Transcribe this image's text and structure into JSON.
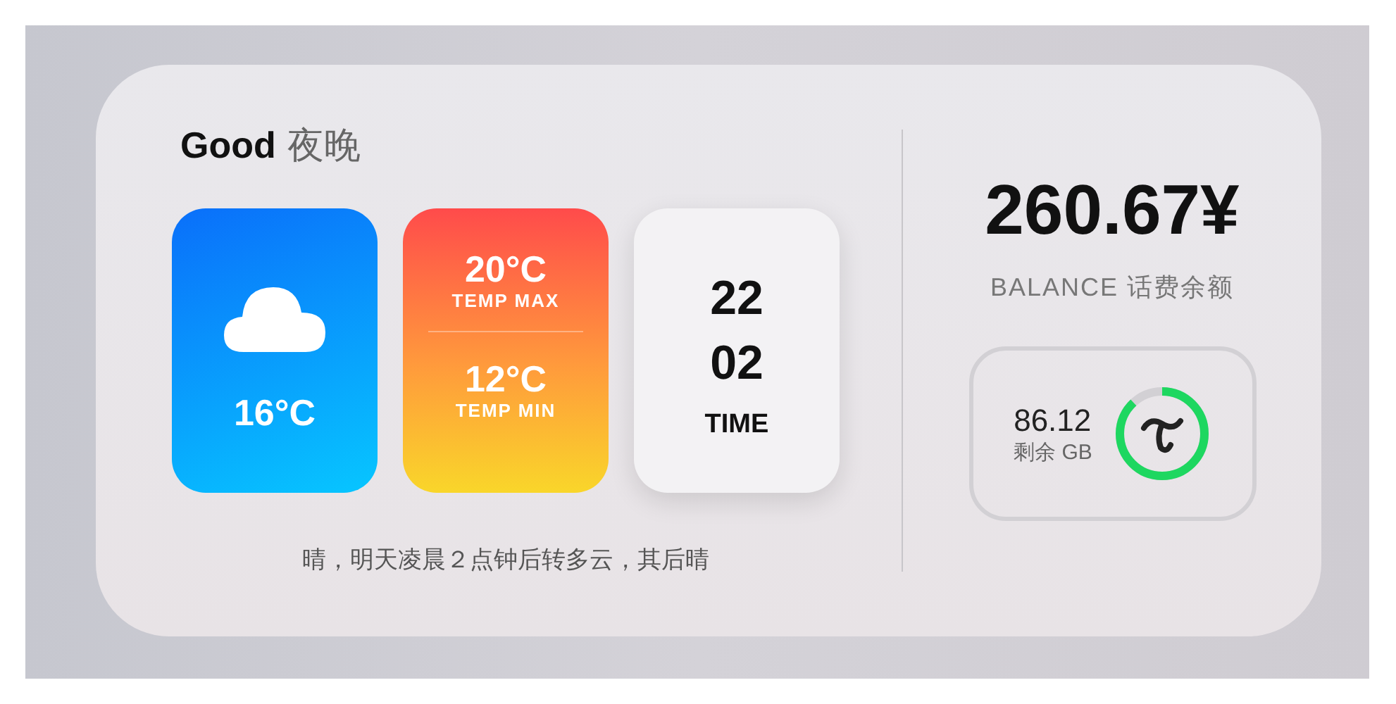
{
  "greeting": {
    "lead": "Good",
    "rest": "夜晚"
  },
  "weather": {
    "temp": "16°C"
  },
  "temps": [
    {
      "value": "20°C",
      "label": "TEMP MAX"
    },
    {
      "value": "12°C",
      "label": "TEMP MIN"
    }
  ],
  "time": {
    "hour": "22",
    "minute": "02",
    "label": "TIME"
  },
  "forecast": "晴，明天凌晨２点钟后转多云，其后晴",
  "balance": {
    "amount": "260.67¥",
    "label": "BALANCE 话费余额"
  },
  "data": {
    "value": "86.12",
    "unit": "剩余 GB"
  }
}
